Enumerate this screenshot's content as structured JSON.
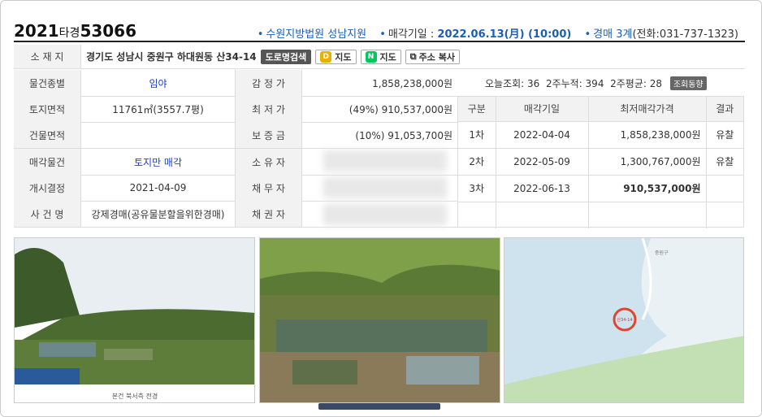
{
  "header": {
    "case_year": "2021",
    "case_type": "타경",
    "case_no": "53066",
    "court": "수원지방법원 성남지원",
    "sale_date_label": "매각기일 : ",
    "sale_date": "2022.06.13(月) (10:00)",
    "dept": "경매 3계",
    "phone": "(전화:031-737-1323)"
  },
  "details": {
    "location_label": "소 재 지",
    "location": "경기도 성남시 중원구 하대원동 산34-14",
    "road_btn": "도로명검색",
    "map_btn1": "지도",
    "map_btn2": "지도",
    "copy_btn": "주소 복사",
    "rows": [
      {
        "l1": "물건종별",
        "v1": "임야",
        "l2": "감 정 가",
        "v2": "1,858,238,000원"
      },
      {
        "l1": "토지면적",
        "v1": "11761㎡(3557.7평)",
        "l2": "최 저 가",
        "v2": "(49%) 910,537,000원"
      },
      {
        "l1": "건물면적",
        "v1": "",
        "l2": "보 증 금",
        "v2": "(10%) 91,053,700원"
      },
      {
        "l1": "매각물건",
        "v1": "토지만 매각",
        "l2": "소 유 자",
        "v2": ""
      },
      {
        "l1": "개시결정",
        "v1": "2021-04-09",
        "l2": "채 무 자",
        "v2": ""
      },
      {
        "l1": "사 건 명",
        "v1": "강제경매(공유물분할을위한경매)",
        "l2": "채 권 자",
        "v2": ""
      }
    ]
  },
  "stats": {
    "today": "오늘조회: 36",
    "week2": "2주누적: 394",
    "avg2": "2주평균: 28",
    "trend_btn": "조회동향"
  },
  "history": {
    "headers": [
      "구분",
      "매각기일",
      "최저매각가격",
      "결과"
    ],
    "rows": [
      {
        "round": "1차",
        "date": "2022-04-04",
        "price": "1,858,238,000원",
        "result": "유찰"
      },
      {
        "round": "2차",
        "date": "2022-05-09",
        "price": "1,300,767,000원",
        "result": "유찰"
      },
      {
        "round": "3차",
        "date": "2022-06-13",
        "price": "910,537,000원",
        "result": ""
      }
    ]
  },
  "photos": {
    "caption1": "본건 북서측 전경",
    "map_label1": "중원구",
    "map_label2": "산34-14"
  }
}
